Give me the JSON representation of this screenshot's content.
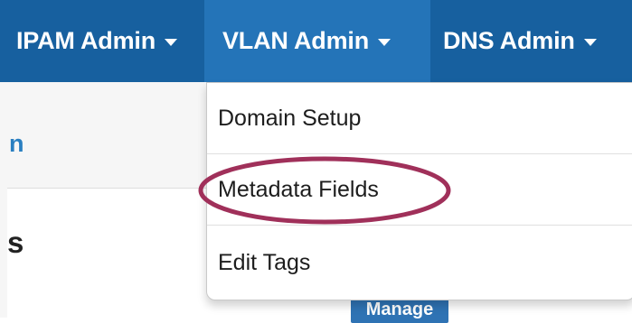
{
  "navbar": {
    "items": [
      {
        "label": "IPAM Admin"
      },
      {
        "label": "VLAN Admin"
      },
      {
        "label": "DNS Admin"
      }
    ]
  },
  "background": {
    "partial_link": "n",
    "partial_heading": "s",
    "manage_label": "Manage"
  },
  "dropdown": {
    "items": [
      {
        "label": "Domain Setup"
      },
      {
        "label": "Metadata Fields"
      },
      {
        "label": "Edit Tags"
      }
    ],
    "highlighted": "Metadata Fields"
  },
  "colors": {
    "navbar": "#17609f",
    "navbar_active": "#2474b8",
    "link": "#2a7fc1",
    "highlight_ellipse": "#a0305a",
    "manage_button": "#2f73b4"
  }
}
